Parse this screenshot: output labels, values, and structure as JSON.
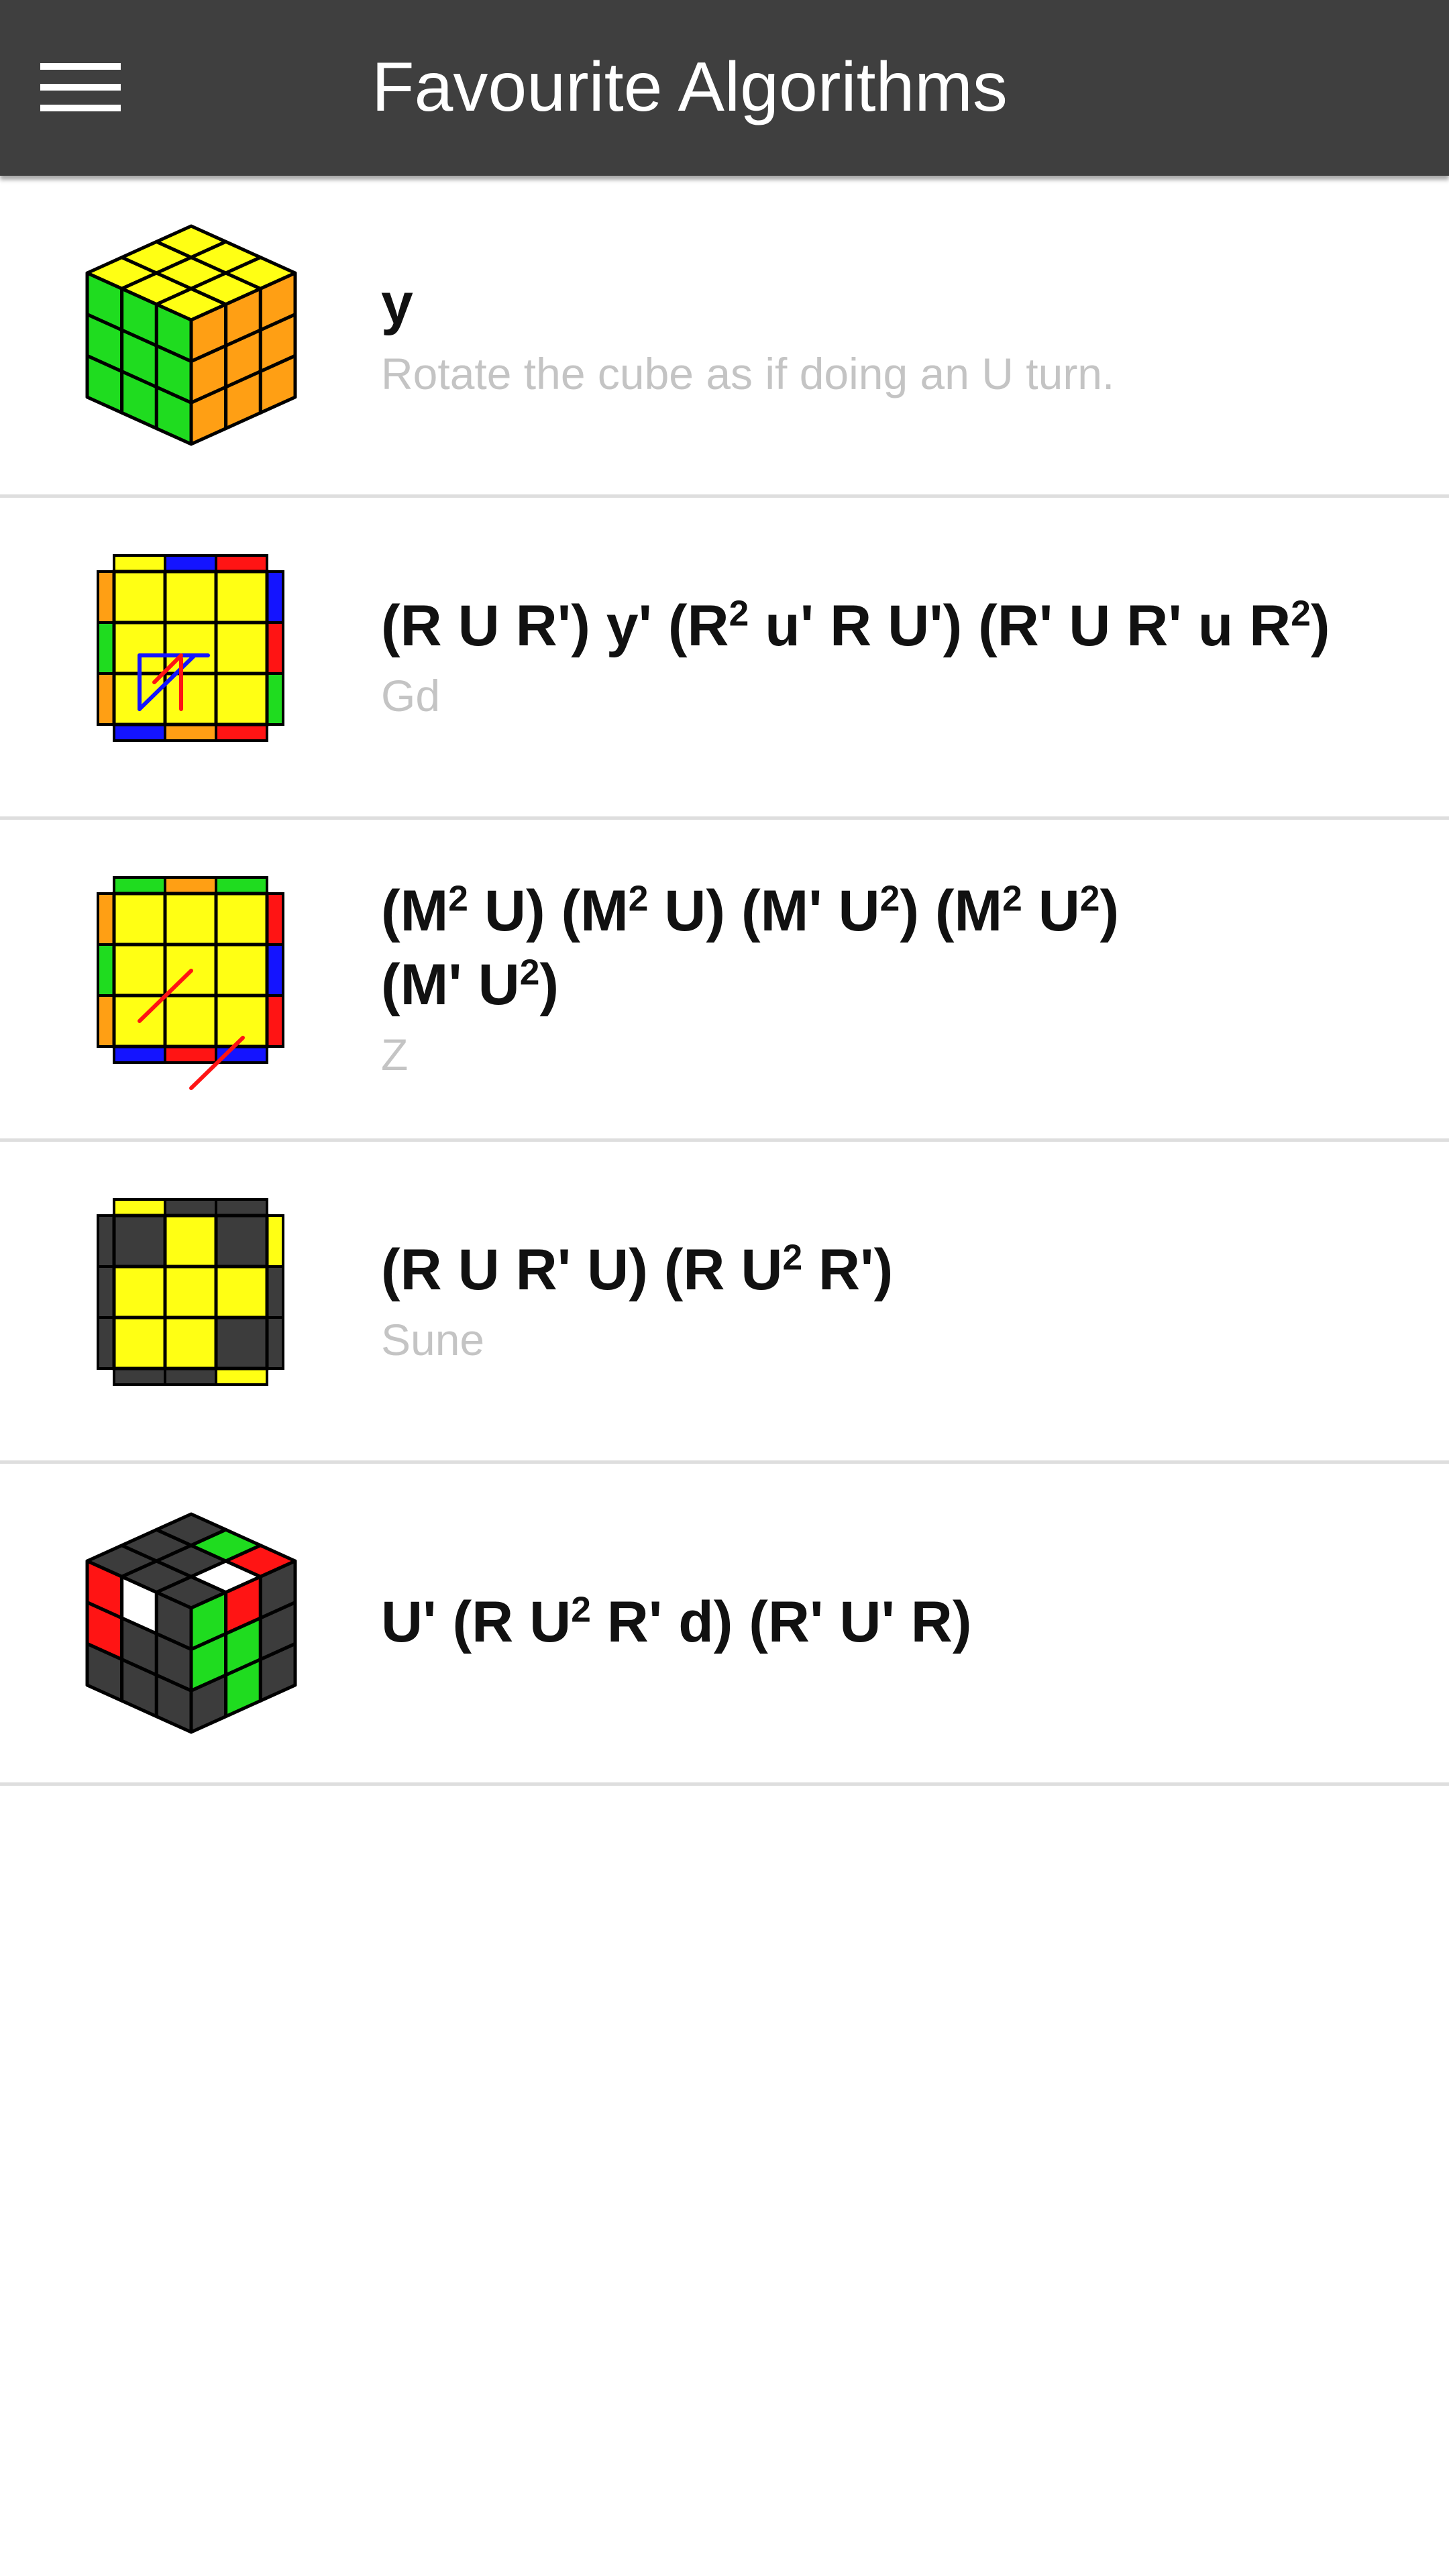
{
  "header": {
    "title": "Favourite Algorithms",
    "menu_icon": "hamburger-menu-icon",
    "background": "#3f3f3f"
  },
  "algorithms": [
    {
      "notation": [
        {
          "t": "y"
        }
      ],
      "name": "Rotate the cube as if doing an U turn.",
      "image": "cube-rotation-icon"
    },
    {
      "notation": [
        {
          "t": "(R U R') y' (R"
        },
        {
          "sup": "2"
        },
        {
          "t": " u' R U') (R' U R' u R"
        },
        {
          "sup": "2"
        },
        {
          "t": ")"
        }
      ],
      "name": "Gd",
      "image": "pll-gd-diagram"
    },
    {
      "notation": [
        {
          "t": "(M"
        },
        {
          "sup": "2"
        },
        {
          "t": " U) (M"
        },
        {
          "sup": "2"
        },
        {
          "t": " U) (M' U"
        },
        {
          "sup": "2"
        },
        {
          "t": ") (M"
        },
        {
          "sup": "2"
        },
        {
          "t": " U"
        },
        {
          "sup": "2"
        },
        {
          "t": ")"
        },
        {
          "br": true
        },
        {
          "t": "(M' U"
        },
        {
          "sup": "2"
        },
        {
          "t": ")"
        }
      ],
      "name": "Z",
      "image": "pll-z-diagram"
    },
    {
      "notation": [
        {
          "t": "(R U R' U) (R U"
        },
        {
          "sup": "2"
        },
        {
          "t": " R')"
        }
      ],
      "name": "Sune",
      "image": "oll-sune-diagram"
    },
    {
      "notation": [
        {
          "t": "U' (R U"
        },
        {
          "sup": "2"
        },
        {
          "t": " R' d) (R' U' R)"
        }
      ],
      "name": "",
      "image": "f2l-case-icon"
    }
  ],
  "colors": {
    "yellow": "#ffff14",
    "green": "#1fdc1f",
    "orange": "#ff9f14",
    "blue": "#1414ff",
    "red": "#ff1414",
    "white": "#ffffff",
    "dark": "#3c3c3c",
    "subtitle": "#c4c4c4",
    "divider": "#dedede"
  }
}
